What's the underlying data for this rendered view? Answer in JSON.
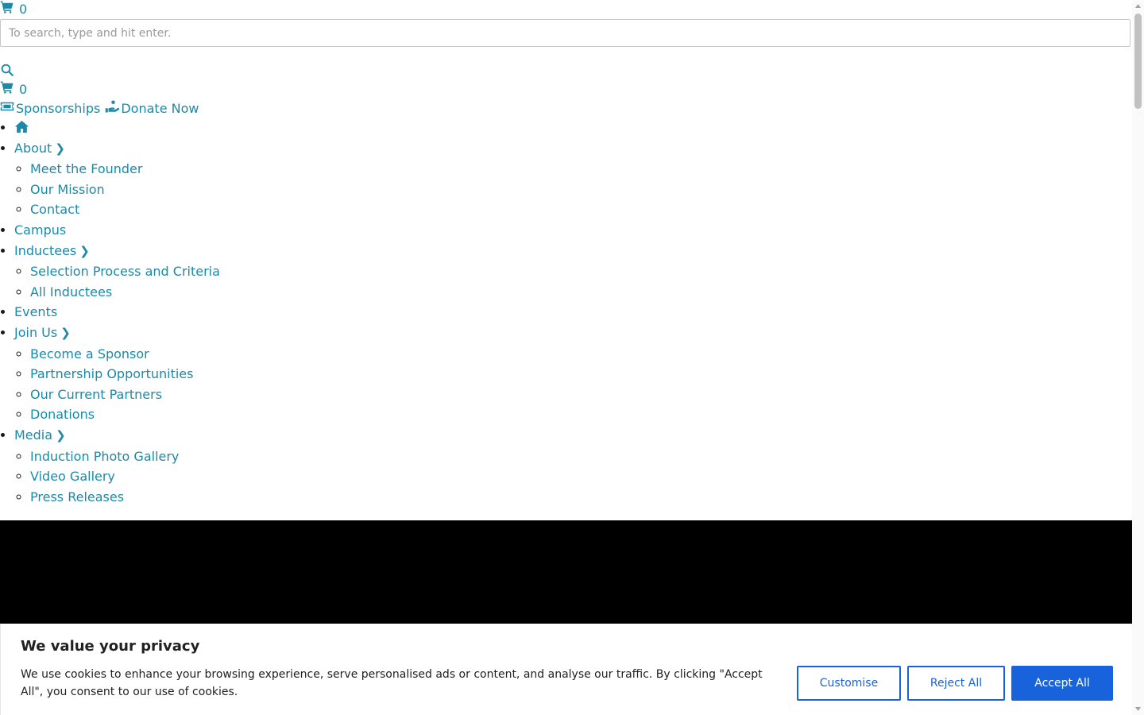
{
  "header": {
    "cart_count_top": "0",
    "search_placeholder": "To search, type and hit enter.",
    "cart_count_second": "0",
    "links": {
      "sponsorships": "Sponsorships",
      "donate": "Donate Now"
    }
  },
  "nav": {
    "about": {
      "label": "About",
      "chevron": "❯",
      "children": [
        "Meet the Founder",
        "Our Mission",
        "Contact"
      ]
    },
    "campus": "Campus",
    "inductees": {
      "label": "Inductees",
      "chevron": "❯",
      "children": [
        "Selection Process and Criteria",
        "All Inductees"
      ]
    },
    "events": "Events",
    "join_us": {
      "label": "Join Us",
      "chevron": "❯",
      "children": [
        "Become a Sponsor",
        "Partnership Opportunities",
        "Our Current Partners",
        "Donations"
      ]
    },
    "media": {
      "label": "Media",
      "chevron": "❯",
      "children": [
        "Induction Photo Gallery",
        "Video Gallery",
        "Press Releases"
      ]
    }
  },
  "cookie_banner": {
    "title": "We value your privacy",
    "text": "We use cookies to enhance your browsing experience, serve personalised ads or content, and analyse our traffic. By clicking \"Accept All\", you consent to our use of cookies.",
    "customise": "Customise",
    "reject": "Reject All",
    "accept": "Accept All"
  },
  "colors": {
    "link": "#1a8aa8",
    "cookie_button": "#1863dc",
    "band": "#000000"
  },
  "icons": [
    "cart-icon",
    "search-icon",
    "ticket-icon",
    "donate-hand-icon",
    "home-icon"
  ]
}
